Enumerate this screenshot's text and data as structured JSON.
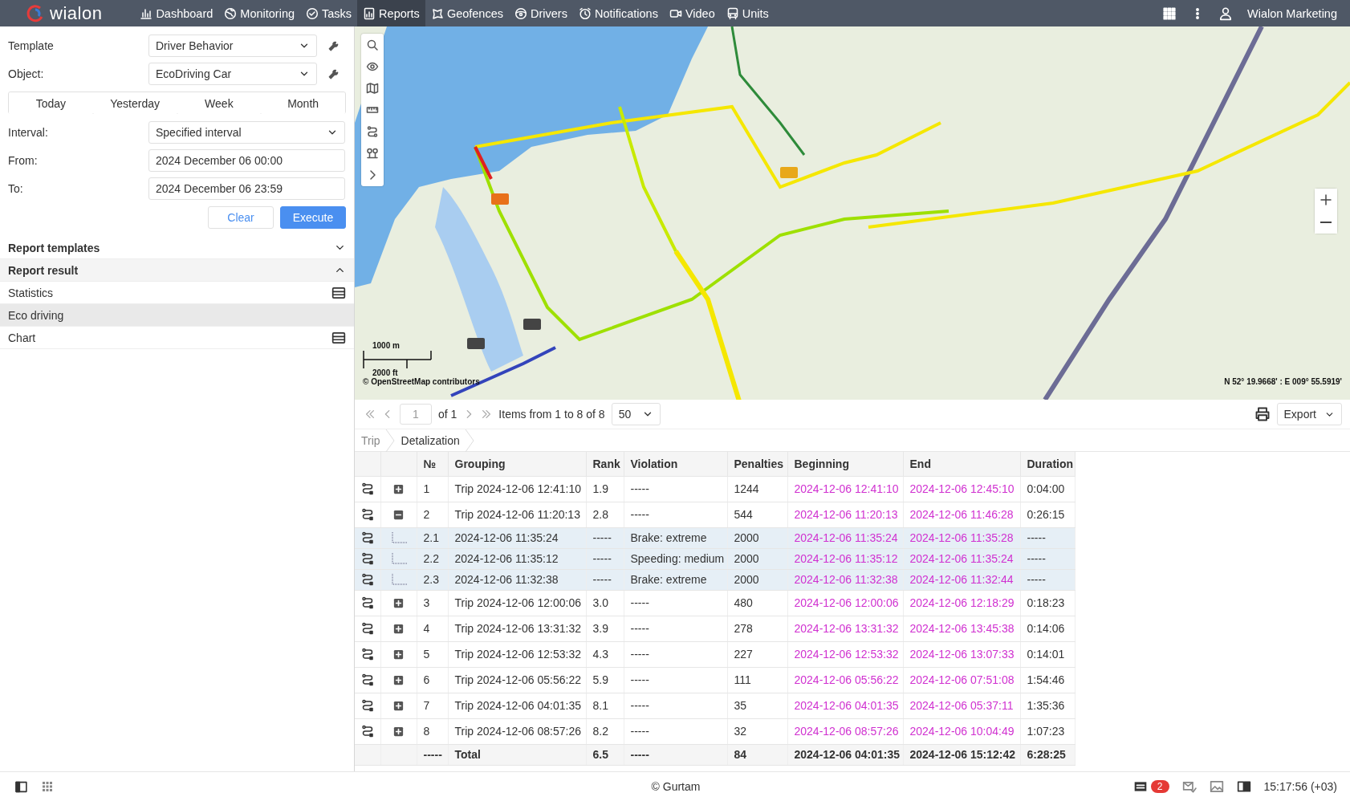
{
  "topbar": {
    "logo": "wialon",
    "nav": [
      {
        "label": "Dashboard",
        "selected": false
      },
      {
        "label": "Monitoring",
        "selected": false
      },
      {
        "label": "Tasks",
        "selected": false
      },
      {
        "label": "Reports",
        "selected": true
      },
      {
        "label": "Geofences",
        "selected": false
      },
      {
        "label": "Drivers",
        "selected": false
      },
      {
        "label": "Notifications",
        "selected": false
      },
      {
        "label": "Video",
        "selected": false
      },
      {
        "label": "Units",
        "selected": false
      }
    ],
    "user": "Wialon Marketing"
  },
  "form": {
    "top_fields": [
      {
        "label": "Template",
        "kind": "select",
        "value": "Driver Behavior"
      },
      {
        "label": "Object:",
        "kind": "select",
        "value": "EcoDriving Car"
      }
    ],
    "periods": [
      {
        "label": "Today",
        "selected": false
      },
      {
        "label": "Yesterday",
        "selected": false
      },
      {
        "label": "Week",
        "selected": false
      },
      {
        "label": "Month",
        "selected": false
      }
    ],
    "fields": [
      {
        "label": "Interval:",
        "kind": "select",
        "value": "Specified interval"
      },
      {
        "label": "From:",
        "kind": "text",
        "value": "2024 December 06 00:00"
      },
      {
        "label": "To:",
        "kind": "text",
        "value": "2024 December 06 23:59"
      }
    ],
    "buttons": [
      {
        "label": "Clear",
        "kind": "secondary"
      },
      {
        "label": "Execute",
        "kind": "primary"
      }
    ]
  },
  "sections": [
    {
      "title": "Report templates",
      "expanded": false
    },
    {
      "title": "Report result",
      "expanded": true,
      "items": [
        {
          "label": "Statistics",
          "table_icon": true,
          "selected": false
        },
        {
          "label": "Eco driving",
          "table_icon": false,
          "selected": true
        },
        {
          "label": "Chart",
          "table_icon": true,
          "selected": false
        }
      ]
    }
  ],
  "map": {
    "scale": [
      "1000 m",
      "2000 ft"
    ],
    "attribution": "© OpenStreetMap contributors",
    "coordinates": "N 52° 19.9668' : E 009° 55.5919'"
  },
  "pager": {
    "page": "1",
    "of": "of 1",
    "items": "Items from 1 to 8 of 8",
    "page_size": "50",
    "export": "Export"
  },
  "breadcrumb": [
    {
      "label": "Trip",
      "selected": false
    },
    {
      "label": "Detalization",
      "selected": true
    }
  ],
  "table": {
    "columns": [
      "№",
      "Grouping",
      "Rank",
      "Violation",
      "Penalties",
      "Beginning",
      "End",
      "Duration"
    ],
    "rows": [
      {
        "kind": "trip",
        "no": "1",
        "grouping": "Trip 2024-12-06 12:41:10",
        "rank": "1.9",
        "violation": "-----",
        "penalties": "1244",
        "beginning": "2024-12-06 12:41:10",
        "end": "2024-12-06 12:45:10",
        "duration": "0:04:00",
        "expanded": false
      },
      {
        "kind": "trip",
        "no": "2",
        "grouping": "Trip 2024-12-06 11:20:13",
        "rank": "2.8",
        "violation": "-----",
        "penalties": "544",
        "beginning": "2024-12-06 11:20:13",
        "end": "2024-12-06 11:46:28",
        "duration": "0:26:15",
        "expanded": true,
        "children": [
          {
            "kind": "event",
            "no": "2.1",
            "grouping": "2024-12-06 11:35:24",
            "rank": "-----",
            "violation": "Brake: extreme",
            "penalties": "2000",
            "beginning": "2024-12-06 11:35:24",
            "end": "2024-12-06 11:35:28",
            "duration": "-----"
          },
          {
            "kind": "event",
            "no": "2.2",
            "grouping": "2024-12-06 11:35:12",
            "rank": "-----",
            "violation": "Speeding: medium",
            "penalties": "2000",
            "beginning": "2024-12-06 11:35:12",
            "end": "2024-12-06 11:35:24",
            "duration": "-----"
          },
          {
            "kind": "event",
            "no": "2.3",
            "grouping": "2024-12-06 11:32:38",
            "rank": "-----",
            "violation": "Brake: extreme",
            "penalties": "2000",
            "beginning": "2024-12-06 11:32:38",
            "end": "2024-12-06 11:32:44",
            "duration": "-----"
          }
        ]
      },
      {
        "kind": "trip",
        "no": "3",
        "grouping": "Trip 2024-12-06 12:00:06",
        "rank": "3.0",
        "violation": "-----",
        "penalties": "480",
        "beginning": "2024-12-06 12:00:06",
        "end": "2024-12-06 12:18:29",
        "duration": "0:18:23",
        "expanded": false
      },
      {
        "kind": "trip",
        "no": "4",
        "grouping": "Trip 2024-12-06 13:31:32",
        "rank": "3.9",
        "violation": "-----",
        "penalties": "278",
        "beginning": "2024-12-06 13:31:32",
        "end": "2024-12-06 13:45:38",
        "duration": "0:14:06",
        "expanded": false
      },
      {
        "kind": "trip",
        "no": "5",
        "grouping": "Trip 2024-12-06 12:53:32",
        "rank": "4.3",
        "violation": "-----",
        "penalties": "227",
        "beginning": "2024-12-06 12:53:32",
        "end": "2024-12-06 13:07:33",
        "duration": "0:14:01",
        "expanded": false
      },
      {
        "kind": "trip",
        "no": "6",
        "grouping": "Trip 2024-12-06 05:56:22",
        "rank": "5.9",
        "violation": "-----",
        "penalties": "111",
        "beginning": "2024-12-06 05:56:22",
        "end": "2024-12-06 07:51:08",
        "duration": "1:54:46",
        "expanded": false
      },
      {
        "kind": "trip",
        "no": "7",
        "grouping": "Trip 2024-12-06 04:01:35",
        "rank": "8.1",
        "violation": "-----",
        "penalties": "35",
        "beginning": "2024-12-06 04:01:35",
        "end": "2024-12-06 05:37:11",
        "duration": "1:35:36",
        "expanded": false
      },
      {
        "kind": "trip",
        "no": "8",
        "grouping": "Trip 2024-12-06 08:57:26",
        "rank": "8.2",
        "violation": "-----",
        "penalties": "32",
        "beginning": "2024-12-06 08:57:26",
        "end": "2024-12-06 10:04:49",
        "duration": "1:07:23",
        "expanded": false
      }
    ],
    "total": {
      "no": "-----",
      "grouping": "Total",
      "rank": "6.5",
      "violation": "-----",
      "penalties": "84",
      "beginning": "2024-12-06 04:01:35",
      "end": "2024-12-06 15:12:42",
      "duration": "6:28:25"
    }
  },
  "status_bar": {
    "copyright": "© Gurtam",
    "badge": "2",
    "time": "15:17:56 (+03)"
  }
}
